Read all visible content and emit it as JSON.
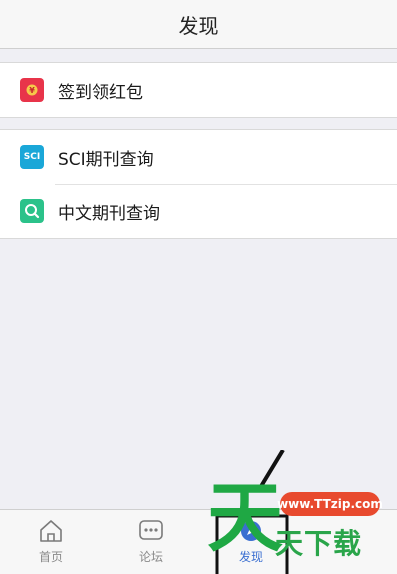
{
  "header": {
    "title": "发现"
  },
  "groups": [
    {
      "items": [
        {
          "label": "签到领红包",
          "icon": "red-envelope-icon"
        }
      ]
    },
    {
      "items": [
        {
          "label": "SCI期刊查询",
          "icon": "sci-icon",
          "icon_text": "SCI"
        },
        {
          "label": "中文期刊查询",
          "icon": "magnifier-icon"
        }
      ]
    }
  ],
  "tabbar": {
    "tabs": [
      {
        "label": "首页",
        "icon": "home-icon"
      },
      {
        "label": "论坛",
        "icon": "chat-bubble-icon"
      },
      {
        "label": "发现",
        "icon": "compass-icon",
        "active": true
      }
    ]
  },
  "watermark": {
    "url": "www.TTzip.com",
    "text": "天下载",
    "big_char": "天"
  },
  "colors": {
    "accent": "#3b6fd1",
    "red_envelope": "#e8344a",
    "sci": "#1aa7d8",
    "magnifier": "#2bc28a",
    "watermark_green": "#1fa844",
    "watermark_red": "#e84a2e"
  }
}
